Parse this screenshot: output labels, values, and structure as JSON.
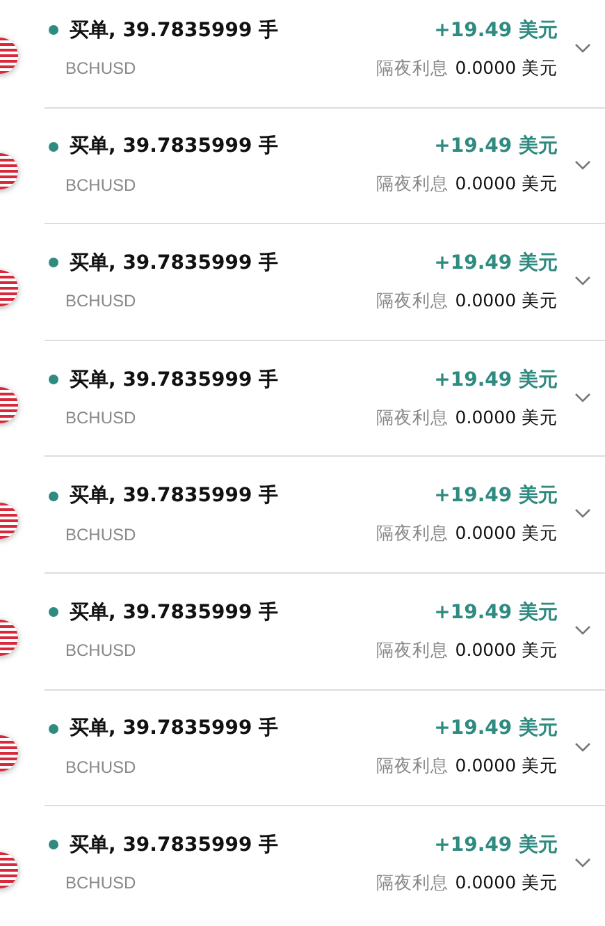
{
  "positions": [
    {
      "title": "买单, 39.7835999 手",
      "symbol": "BCHUSD",
      "profit": "+19.49 美元",
      "swap_label": "隔夜利息",
      "swap_value": "0.0000 美元",
      "expanded": false
    },
    {
      "title": "买单, 39.7835999 手",
      "symbol": "BCHUSD",
      "profit": "+19.49 美元",
      "swap_label": "隔夜利息",
      "swap_value": "0.0000 美元",
      "expanded": false
    },
    {
      "title": "买单, 39.7835999 手",
      "symbol": "BCHUSD",
      "profit": "+19.49 美元",
      "swap_label": "隔夜利息",
      "swap_value": "0.0000 美元",
      "expanded": false
    },
    {
      "title": "买单, 39.7835999 手",
      "symbol": "BCHUSD",
      "profit": "+19.49 美元",
      "swap_label": "隔夜利息",
      "swap_value": "0.0000 美元",
      "expanded": false
    },
    {
      "title": "买单, 39.7835999 手",
      "symbol": "BCHUSD",
      "profit": "+19.49 美元",
      "swap_label": "隔夜利息",
      "swap_value": "0.0000 美元",
      "expanded": false
    },
    {
      "title": "买单, 39.7835999 手",
      "symbol": "BCHUSD",
      "profit": "+19.49 美元",
      "swap_label": "隔夜利息",
      "swap_value": "0.0000 美元",
      "expanded": false
    },
    {
      "title": "买单, 39.7835999 手",
      "symbol": "BCHUSD",
      "profit": "+19.49 美元",
      "swap_label": "隔夜利息",
      "swap_value": "0.0000 美元",
      "expanded": false
    },
    {
      "title": "买单, 39.7835999 手",
      "symbol": "BCHUSD",
      "profit": "+19.49 美元",
      "swap_label": "隔夜利息",
      "swap_value": "0.0000 美元",
      "expanded": false
    }
  ]
}
